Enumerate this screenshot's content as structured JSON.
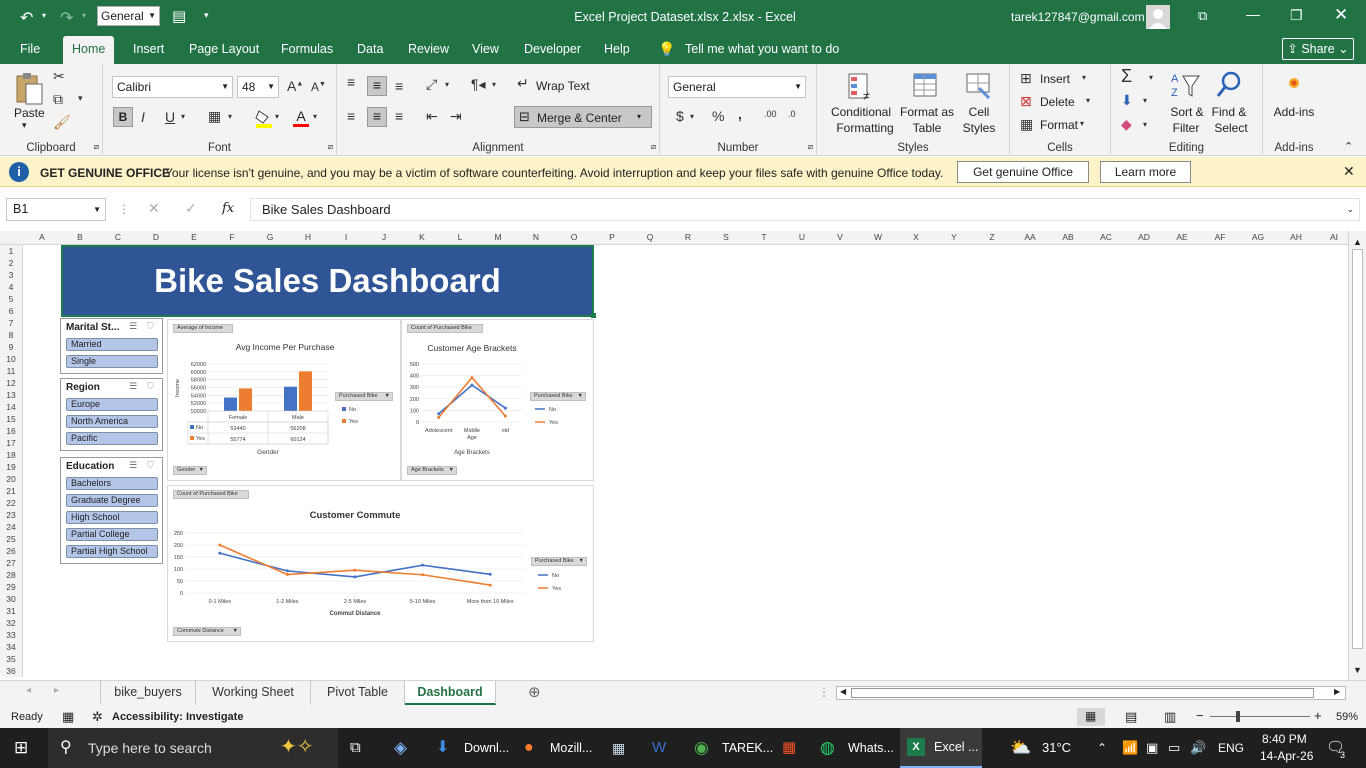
{
  "title_bar": {
    "number_format": "General",
    "title": "Excel Project Dataset.xlsx 2.xlsx  -  Excel",
    "account": "tarek127847@gmail.com"
  },
  "ribbon_tabs": [
    "File",
    "Home",
    "Insert",
    "Page Layout",
    "Formulas",
    "Data",
    "Review",
    "View",
    "Developer",
    "Help"
  ],
  "tell_me": "Tell me what you want to do",
  "share": "Share",
  "ribbon": {
    "clipboard": {
      "paste": "Paste",
      "label": "Clipboard"
    },
    "font": {
      "name": "Calibri",
      "size": "48",
      "label": "Font",
      "bold": "B",
      "italic": "I",
      "underline": "U"
    },
    "alignment": {
      "wrap": "Wrap Text",
      "merge": "Merge & Center",
      "label": "Alignment"
    },
    "number": {
      "format": "General",
      "label": "Number",
      "currency": "$",
      "percent": "%",
      "comma": ","
    },
    "styles": {
      "conditional_1": "Conditional",
      "conditional_2": "Formatting",
      "format_table_1": "Format as",
      "format_table_2": "Table",
      "cell_styles_1": "Cell",
      "cell_styles_2": "Styles",
      "label": "Styles"
    },
    "cells": {
      "insert": "Insert",
      "delete": "Delete",
      "format": "Format",
      "label": "Cells"
    },
    "editing": {
      "sort_1": "Sort &",
      "sort_2": "Filter",
      "find_1": "Find &",
      "find_2": "Select",
      "label": "Editing"
    },
    "addins": {
      "label_btn": "Add-ins",
      "label": "Add-ins"
    }
  },
  "message_bar": {
    "title": "GET GENUINE OFFICE",
    "text": "Your license isn't genuine, and you may be a victim of software counterfeiting. Avoid interruption and keep your files safe with genuine Office today.",
    "btn1": "Get genuine Office",
    "btn2": "Learn more"
  },
  "formula_bar": {
    "name_box": "B1",
    "fx": "fx",
    "content": "Bike Sales Dashboard"
  },
  "columns": [
    "A",
    "B",
    "C",
    "D",
    "E",
    "F",
    "G",
    "H",
    "I",
    "J",
    "K",
    "L",
    "M",
    "N",
    "O",
    "P",
    "Q",
    "R",
    "S",
    "T",
    "U",
    "V",
    "W",
    "X",
    "Y",
    "Z",
    "AA",
    "AB",
    "AC",
    "AD",
    "AE",
    "AF",
    "AG",
    "AH",
    "AI"
  ],
  "rows": [
    "1",
    "2",
    "3",
    "4",
    "5",
    "6",
    "7",
    "8",
    "9",
    "10",
    "11",
    "12",
    "13",
    "14",
    "15",
    "16",
    "17",
    "18",
    "19",
    "20",
    "21",
    "22",
    "23",
    "24",
    "25",
    "26",
    "27",
    "28",
    "29",
    "30",
    "31",
    "32",
    "33",
    "34",
    "35",
    "36"
  ],
  "dashboard_title": "Bike Sales Dashboard",
  "slicers": [
    {
      "title": "Marital St...",
      "items": [
        "Married",
        "Single"
      ]
    },
    {
      "title": "Region",
      "items": [
        "Europe",
        "North America",
        "Pacific"
      ]
    },
    {
      "title": "Education",
      "items": [
        "Bachelors",
        "Graduate Degree",
        "High School",
        "Partial College",
        "Partial High School"
      ]
    }
  ],
  "chart_data": [
    {
      "type": "bar",
      "title": "Avg Income Per Purchase",
      "field_button": "Average of Income",
      "xlabel": "Gender",
      "ylabel": "Income",
      "categories": [
        "Female",
        "Male"
      ],
      "series": [
        {
          "name": "No",
          "values": [
            53440,
            56208
          ]
        },
        {
          "name": "Yes",
          "values": [
            55774,
            60124
          ]
        }
      ],
      "ylim": [
        50000,
        62000
      ],
      "yticks": [
        50000,
        52000,
        54000,
        56000,
        58000,
        60000,
        62000
      ],
      "legend_title": "Purchased Bike",
      "axis_button": "Gender",
      "colors": {
        "No": "#4472c4",
        "Yes": "#ed7d31"
      }
    },
    {
      "type": "line",
      "title": "Customer Age Brackets",
      "field_button": "Count of Purchased Bike",
      "xlabel": "Age Brackets",
      "categories": [
        "Adolescent",
        "Middle Age",
        "old"
      ],
      "series": [
        {
          "name": "No",
          "values": [
            71,
            318,
            120
          ]
        },
        {
          "name": "Yes",
          "values": [
            39,
            383,
            52
          ]
        }
      ],
      "ylim": [
        0,
        500
      ],
      "yticks": [
        0,
        100,
        200,
        300,
        400,
        500
      ],
      "legend_title": "Purchased Bike",
      "axis_button": "Age Brackets"
    },
    {
      "type": "line",
      "title": "Customer Commute",
      "field_button": "Count of Purchased Bike",
      "xlabel": "Commut Distance",
      "categories": [
        "0-1 Miles",
        "1-2 Miles",
        "2-5 Miles",
        "5-10 Miles",
        "More then 10 Miles"
      ],
      "series": [
        {
          "name": "No",
          "values": [
            166,
            92,
            67,
            116,
            78
          ]
        },
        {
          "name": "Yes",
          "values": [
            200,
            77,
            95,
            76,
            33
          ]
        }
      ],
      "ylim": [
        0,
        250
      ],
      "yticks": [
        0,
        50,
        100,
        150,
        200,
        250
      ],
      "legend_title": "Purchased Bike",
      "axis_button": "Commute Distance"
    }
  ],
  "sheet_tabs": [
    "bike_buyers",
    "Working Sheet",
    "Pivot Table",
    "Dashboard"
  ],
  "status": {
    "ready": "Ready",
    "accessibility": "Accessibility: Investigate",
    "zoom": "59%"
  },
  "taskbar": {
    "search": "Type here to search",
    "items": [
      "Downl...",
      "Mozill...",
      "TAREK...",
      "Whats...",
      "Excel ..."
    ],
    "weather": "31°C",
    "lang": "ENG",
    "time": "8:40 PM",
    "date": "14-Apr-26",
    "notif": "3"
  }
}
